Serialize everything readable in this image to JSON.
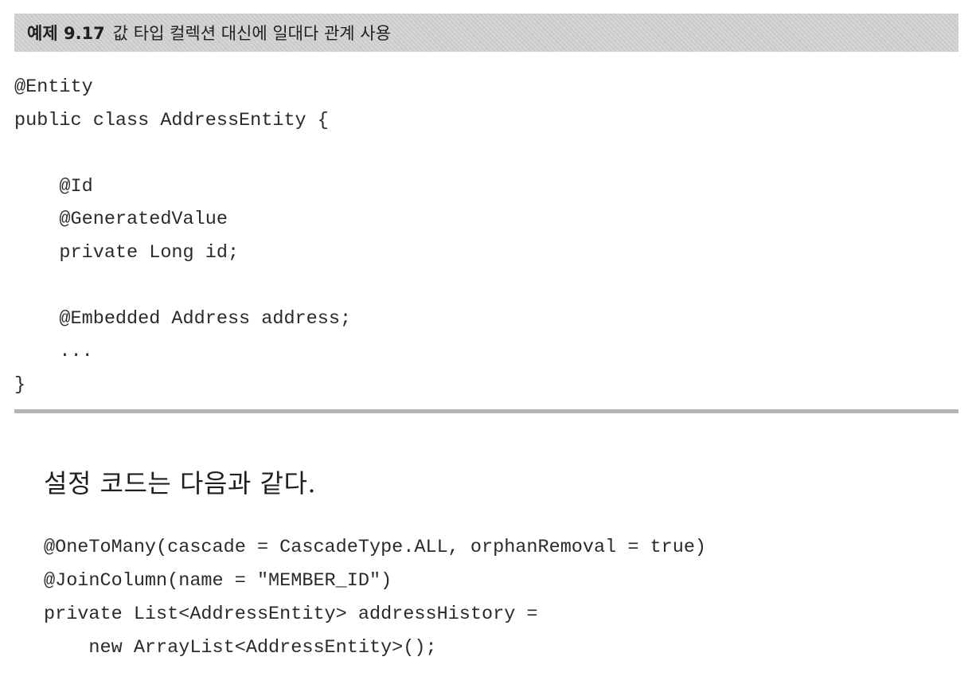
{
  "example": {
    "number": "예제 9.17",
    "title": "값 타입 컬렉션 대신에 일대다 관계 사용"
  },
  "code_block_1": {
    "lines": [
      "@Entity",
      "public class AddressEntity {",
      "",
      "    @Id",
      "    @GeneratedValue",
      "    private Long id;",
      "",
      "    @Embedded Address address;",
      "    ...",
      "}"
    ]
  },
  "prose": {
    "text": "설정 코드는 다음과 같다."
  },
  "code_block_2": {
    "lines": [
      "@OneToMany(cascade = CascadeType.ALL, orphanRemoval = true)",
      "@JoinColumn(name = \"MEMBER_ID\")",
      "private List<AddressEntity> addressHistory =",
      "    new ArrayList<AddressEntity>();"
    ]
  }
}
